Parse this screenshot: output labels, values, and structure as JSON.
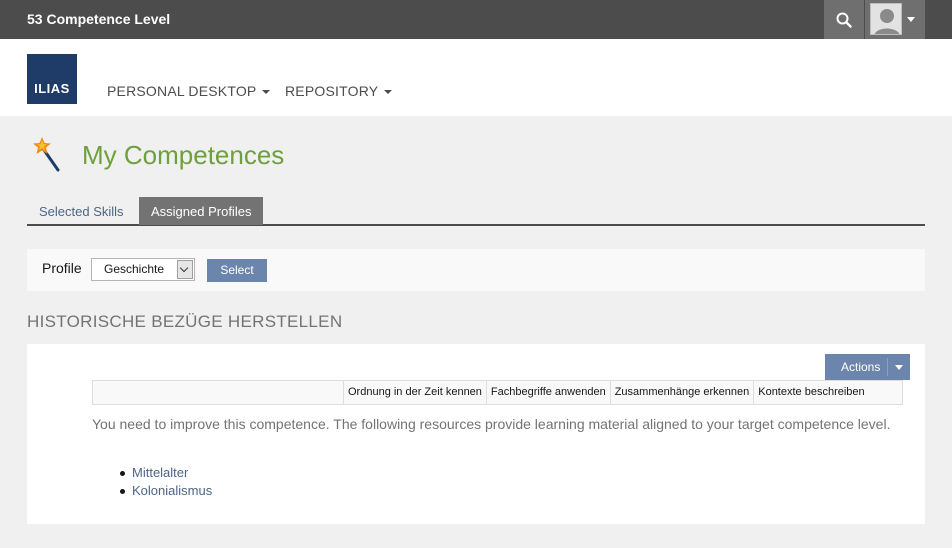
{
  "topbar": {
    "title": "53 Competence Level"
  },
  "logo": {
    "text": "ILIAS"
  },
  "nav": {
    "items": [
      {
        "label": "PERSONAL DESKTOP"
      },
      {
        "label": "REPOSITORY"
      }
    ]
  },
  "page": {
    "title": "My Competences",
    "icon": "magic-wand-icon"
  },
  "tabs": [
    {
      "label": "Selected Skills",
      "active": false
    },
    {
      "label": "Assigned Profiles",
      "active": true
    }
  ],
  "profile": {
    "label": "Profile",
    "selected": "Geschichte",
    "button_label": "Select"
  },
  "section": {
    "heading": "HISTORISCHE BEZÜGE HERSTELLEN"
  },
  "panel": {
    "actions_label": "Actions",
    "columns": [
      "",
      "Ordnung in der Zeit kennen",
      "Fachbegriffe anwenden",
      "Zusammenhänge erkennen",
      "Kontexte beschreiben"
    ],
    "notice": "You need to improve this competence. The following resources provide learning material aligned to your target competence level.",
    "resources": [
      "Mittelalter",
      "Kolonialismus"
    ]
  },
  "colors": {
    "topbar": "#4c4c4c",
    "accent_green": "#6ea03c",
    "button_blue": "#6c85ac",
    "link_blue": "#4c6586"
  }
}
